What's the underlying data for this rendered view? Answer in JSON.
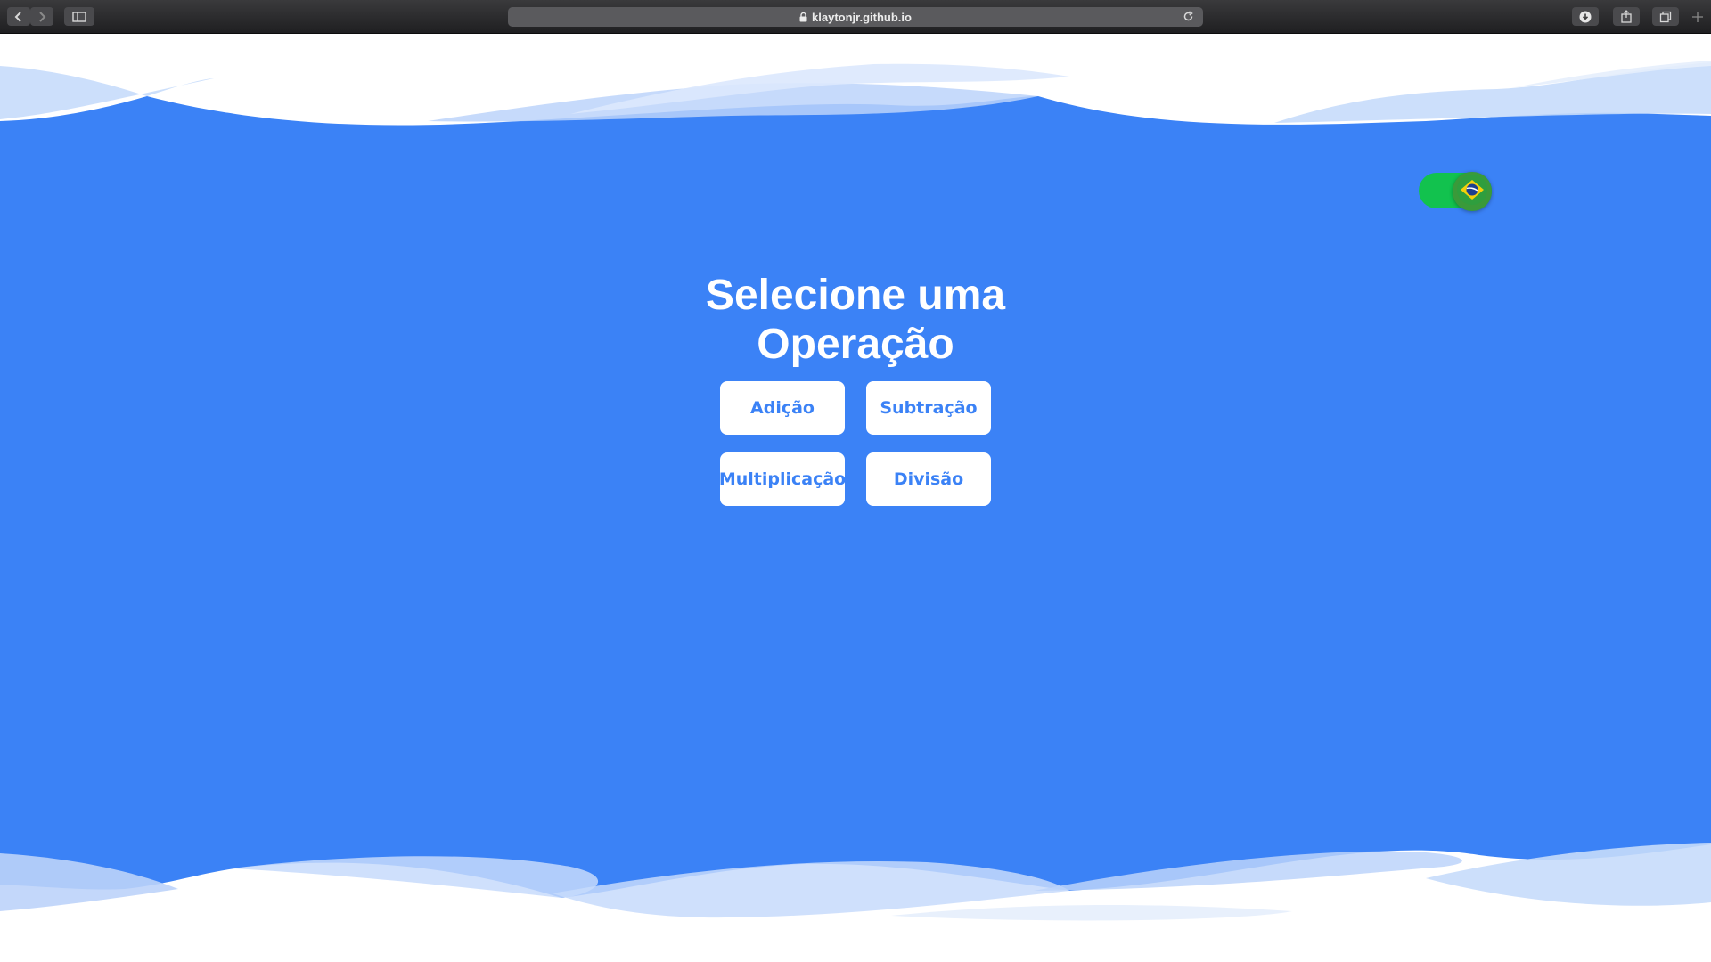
{
  "browser": {
    "url": "klaytonjr.github.io",
    "icons": {
      "back": "chevron-left-icon",
      "forward": "chevron-right-icon",
      "sidebar": "sidebar-icon",
      "lock": "lock-icon",
      "reload": "reload-icon",
      "download": "download-icon",
      "share": "share-icon",
      "tabs": "tabs-overview-icon",
      "new_tab": "plus-icon"
    }
  },
  "main": {
    "title_line1": "Selecione uma",
    "title_line2": "Operação",
    "operations": {
      "addition": "Adição",
      "subtraction": "Subtração",
      "multiplication": "Multiplicação",
      "division": "Divisão"
    }
  },
  "language_toggle": {
    "flag_icon": "brazil-flag-icon",
    "state": "on"
  },
  "colors": {
    "background_blue": "#3b82f6",
    "button_text": "#3b82f6",
    "toggle_green": "#12c24e"
  }
}
